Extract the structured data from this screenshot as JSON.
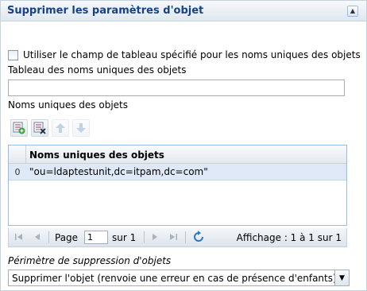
{
  "panel": {
    "title": "Supprimer les paramètres d'objet",
    "collapse_icon": "collapse-up-icon"
  },
  "form": {
    "use_table_field_checkbox_label": "Utiliser le champ de tableau spécifié pour les noms uniques des objets",
    "use_table_field_checked": false,
    "table_label": "Tableau des noms uniques des objets",
    "table_value": "",
    "names_label": "Noms uniques des objets"
  },
  "toolbar": {
    "buttons": [
      {
        "icon": "add-row-icon",
        "enabled": true
      },
      {
        "icon": "delete-row-icon",
        "enabled": true
      },
      {
        "icon": "arrow-up-icon",
        "enabled": false
      },
      {
        "icon": "arrow-down-icon",
        "enabled": false
      }
    ]
  },
  "grid": {
    "column_header": "Noms uniques des objets",
    "rows": [
      {
        "index": "0",
        "value": "\"ou=ldaptestunit,dc=itpam,dc=com\""
      }
    ]
  },
  "pager": {
    "page_label": "Page",
    "page_value": "1",
    "of_label": "sur 1",
    "display_info": "Affichage : 1 à 1 sur 1"
  },
  "scope": {
    "label": "Périmètre de suppression d'objets",
    "selected": "Supprimer l'objet (renvoie une erreur en cas de présence d'enfants)"
  },
  "colors": {
    "title": "#15428b",
    "selected_row": "#dfe8f6",
    "border": "#99bbe8"
  }
}
